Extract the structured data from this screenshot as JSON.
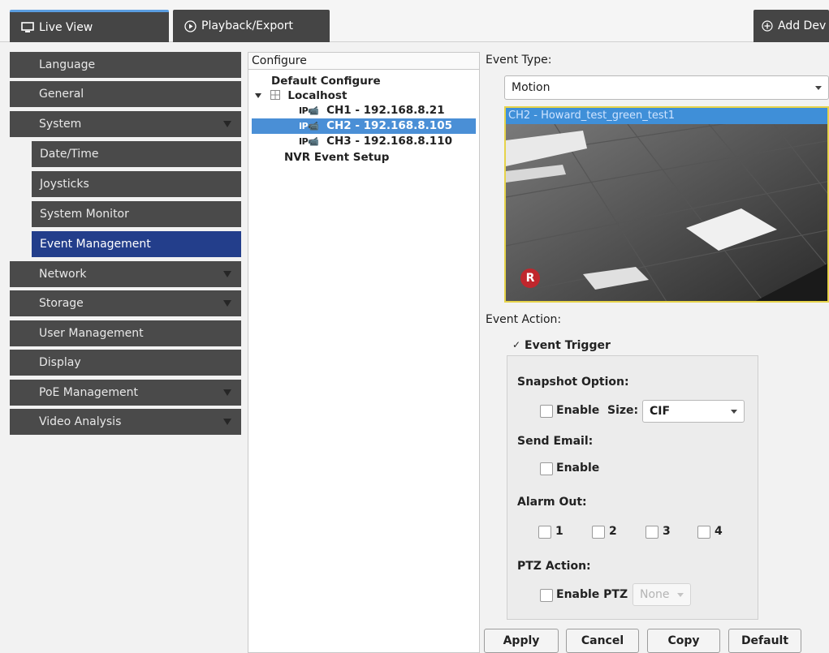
{
  "toptabs": {
    "live_view": "Live View",
    "playback": "Playback/Export",
    "add_device": "Add Dev"
  },
  "sidebar": {
    "items": [
      {
        "label": "Language"
      },
      {
        "label": "General"
      },
      {
        "label": "System"
      },
      {
        "label": "Date/Time"
      },
      {
        "label": "Joysticks"
      },
      {
        "label": "System Monitor"
      },
      {
        "label": "Event Management"
      },
      {
        "label": "Network"
      },
      {
        "label": "Storage"
      },
      {
        "label": "User Management"
      },
      {
        "label": "Display"
      },
      {
        "label": "PoE Management"
      },
      {
        "label": "Video Analysis"
      }
    ]
  },
  "tree": {
    "header": "Configure",
    "default_configure": "Default Configure",
    "localhost": "Localhost",
    "ip_tag": "IP",
    "channels": [
      {
        "label": "CH1 - 192.168.8.21"
      },
      {
        "label": "CH2 - 192.168.8.105"
      },
      {
        "label": "CH3 - 192.168.8.110"
      }
    ],
    "nvr_event_setup": "NVR Event Setup"
  },
  "event": {
    "type_label": "Event Type:",
    "type_value": "Motion",
    "preview_title": "CH2 - Howard_test_green_test1",
    "record_badge": "R",
    "action_label": "Event Action:",
    "trigger_label": "Event Trigger",
    "trigger_checked": true,
    "snapshot_label": "Snapshot Option:",
    "snapshot_enable": "Enable",
    "size_label": "Size:",
    "size_value": "CIF",
    "email_label": "Send Email:",
    "email_enable": "Enable",
    "alarm_label": "Alarm Out:",
    "alarm_outputs": [
      "1",
      "2",
      "3",
      "4"
    ],
    "ptz_label": "PTZ Action:",
    "ptz_enable": "Enable PTZ",
    "ptz_value": "None"
  },
  "buttons": {
    "apply": "Apply",
    "cancel": "Cancel",
    "copy": "Copy",
    "default": "Default"
  },
  "colors": {
    "sidebar_item": "#4a4a4a",
    "sidebar_active": "#233e8b",
    "selection": "#4a8fd6",
    "preview_border": "#e6d34a",
    "record_badge": "#c0272d"
  }
}
